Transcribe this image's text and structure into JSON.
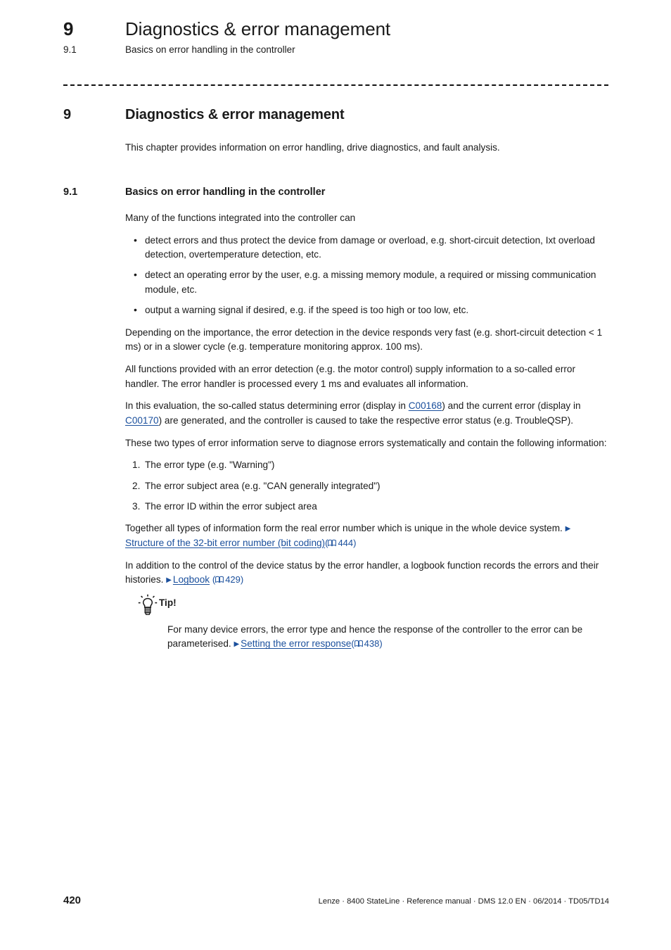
{
  "running_head": {
    "chapter_number": "9",
    "chapter_title": "Diagnostics & error management",
    "section_number": "9.1",
    "section_title": "Basics on error handling in the controller"
  },
  "heading_1": {
    "number": "9",
    "title": "Diagnostics & error management"
  },
  "intro": "This chapter provides information on error handling, drive diagnostics, and fault analysis.",
  "heading_2": {
    "number": "9.1",
    "title": "Basics on error handling in the controller"
  },
  "body": {
    "lead_in": "Many of the functions integrated into the controller can",
    "bullets": [
      "detect errors and thus protect the device from damage or overload, e.g. short-circuit detection, Ixt overload detection, overtemperature detection, etc.",
      "detect an operating error by the user, e.g. a missing memory module, a required or missing communication module, etc.",
      "output a warning signal if desired, e.g. if the speed is too high or too low, etc."
    ],
    "para_importance": "Depending on the importance, the error detection in the device responds very fast (e.g. short-circuit detection < 1 ms) or in a slower cycle (e.g. temperature monitoring approx. 100 ms).",
    "para_error_handler": "All functions provided with an error detection (e.g. the motor control) supply information to a so-called error handler. The error handler is processed every 1 ms and evaluates all information.",
    "para_evaluation": {
      "part_1": "In this evaluation, the so-called status determining error (display in ",
      "link_1": "C00168",
      "part_2": ") and the current error (display in ",
      "link_2": "C00170",
      "part_3": ") are generated, and the controller is caused to take the respective error status (e.g. TroubleQSP)."
    },
    "para_two_types": "These two types of error information serve to diagnose errors systematically and contain the following information:",
    "numbered": [
      "The error type (e.g. \"Warning\")",
      "The error subject area (e.g. \"CAN generally integrated\")",
      "The error ID within the error subject area"
    ],
    "para_together": {
      "text": "Together all types of information form the real error number which is unique in the whole device system.",
      "link_label": "Structure of the 32-bit error number (bit coding)",
      "page_ref": "444"
    },
    "para_logbook": {
      "text": "In addition to the control of the device status by the error handler, a logbook function records the errors and their histories.",
      "link_label": "Logbook",
      "page_ref": "429"
    }
  },
  "tip": {
    "icon": "lightbulb-icon",
    "title": "Tip!",
    "text": "For many device errors, the error type and hence the response of the controller to the error can be parameterised.",
    "link_label": "Setting the error response",
    "page_ref": "438"
  },
  "footer": {
    "page_number": "420",
    "imprint": "Lenze · 8400 StateLine · Reference manual · DMS 12.0 EN · 06/2014 · TD05/TD14"
  },
  "colors": {
    "link": "#1a4f9c",
    "text": "#1a1a1a",
    "background": "#ffffff"
  }
}
